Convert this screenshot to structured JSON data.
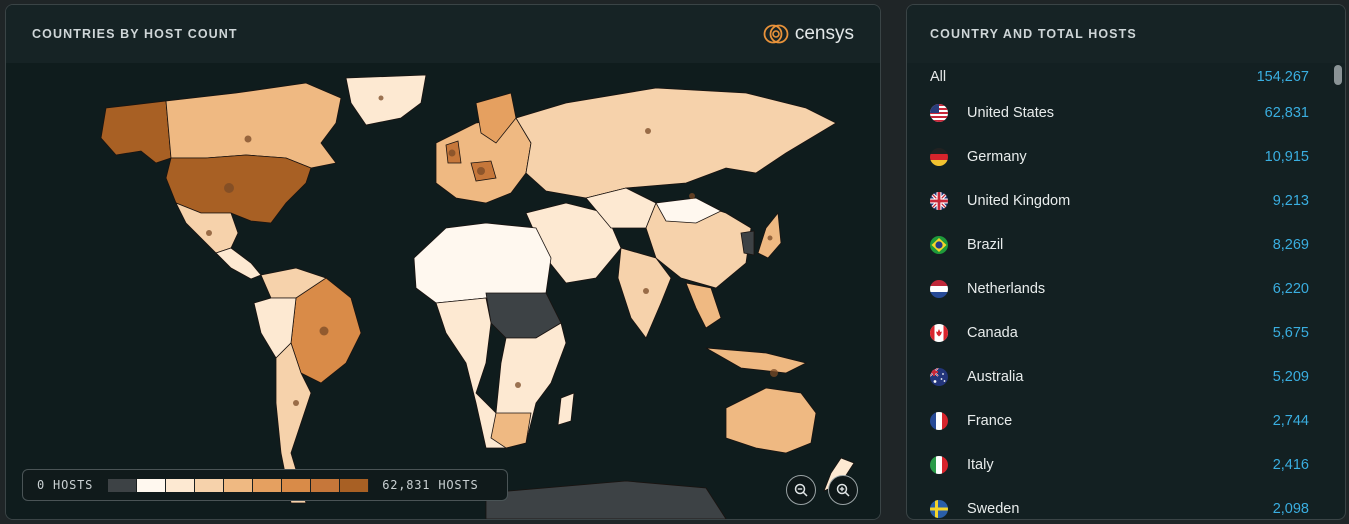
{
  "map_panel": {
    "title": "COUNTRIES BY HOST COUNT",
    "logo_text": "censys",
    "legend": {
      "min_label": "0 HOSTS",
      "max_label": "62,831 HOSTS",
      "colors": [
        "#3d4245",
        "#fff8ef",
        "#fde9d2",
        "#f6d2ab",
        "#efb982",
        "#e5a060",
        "#d98b48",
        "#c6773a",
        "#a86024"
      ]
    },
    "zoom_out_icon": "zoom-out-icon",
    "zoom_in_icon": "zoom-in-icon"
  },
  "list_panel": {
    "title": "COUNTRY AND TOTAL HOSTS",
    "all_label": "All",
    "all_value": "154,267",
    "countries": [
      {
        "name": "United States",
        "value": "62,831",
        "flag": "us"
      },
      {
        "name": "Germany",
        "value": "10,915",
        "flag": "de"
      },
      {
        "name": "United Kingdom",
        "value": "9,213",
        "flag": "gb"
      },
      {
        "name": "Brazil",
        "value": "8,269",
        "flag": "br"
      },
      {
        "name": "Netherlands",
        "value": "6,220",
        "flag": "nl"
      },
      {
        "name": "Canada",
        "value": "5,675",
        "flag": "ca"
      },
      {
        "name": "Australia",
        "value": "5,209",
        "flag": "au"
      },
      {
        "name": "France",
        "value": "2,744",
        "flag": "fr"
      },
      {
        "name": "Italy",
        "value": "2,416",
        "flag": "it"
      },
      {
        "name": "Sweden",
        "value": "2,098",
        "flag": "se"
      }
    ]
  },
  "colors": {
    "accent_value": "#3aaee0",
    "background": "#132022"
  }
}
